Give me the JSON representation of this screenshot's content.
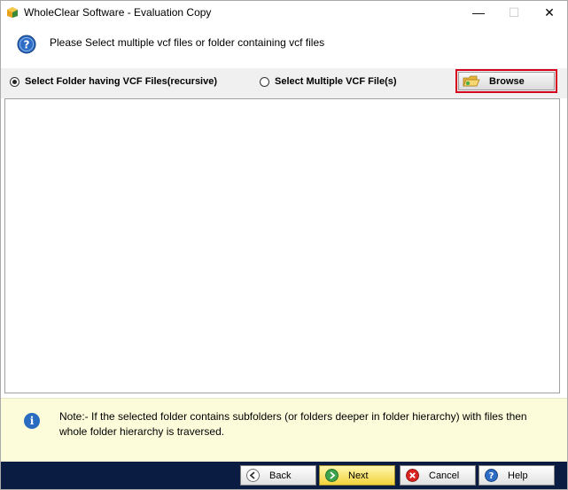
{
  "window": {
    "title": "WholeClear Software - Evaluation Copy",
    "min_glyph": "—",
    "max_glyph": "☐",
    "close_glyph": "✕"
  },
  "header": {
    "icon": "help-icon",
    "text": "Please Select multiple vcf files or folder containing vcf files"
  },
  "options": {
    "folder_label": "Select Folder having VCF Files(recursive)",
    "folder_selected": true,
    "files_label": "Select Multiple VCF File(s)",
    "files_selected": false,
    "browse_label": "Browse",
    "highlight_color": "#d6001c"
  },
  "note": {
    "icon": "info-icon",
    "text": "Note:- If the selected folder contains subfolders (or folders deeper in folder hierarchy) with files then whole folder hierarchy is traversed."
  },
  "buttons": {
    "back": "Back",
    "next": "Next",
    "cancel": "Cancel",
    "help": "Help"
  },
  "colors": {
    "bottom_bar": "#0a1c42",
    "note_bg": "#fcfcda",
    "next_accent": "#f3d33a"
  }
}
